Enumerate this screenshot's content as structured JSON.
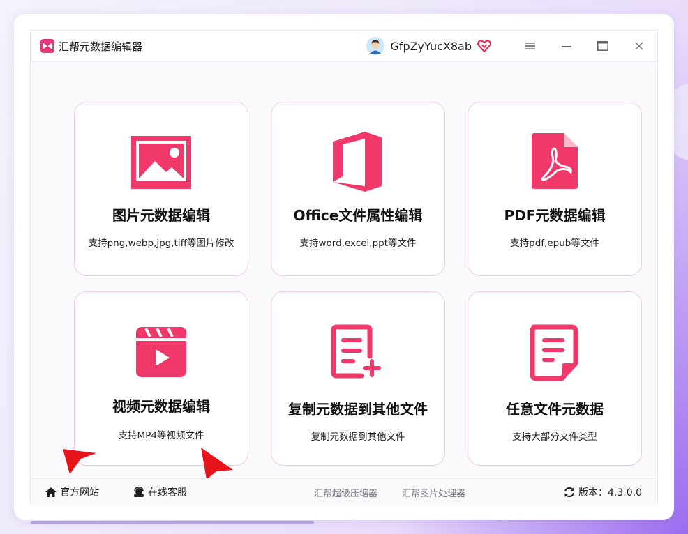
{
  "app": {
    "title": "汇帮元数据编辑器"
  },
  "user": {
    "name": "GfpZyYucX8ab"
  },
  "cards": [
    {
      "title": "图片元数据编辑",
      "subtitle": "支持png,webp,jpg,tiff等图片修改",
      "icon": "image-icon"
    },
    {
      "title": "Office文件属性编辑",
      "subtitle": "支持word,excel,ppt等文件",
      "icon": "office-icon"
    },
    {
      "title": "PDF元数据编辑",
      "subtitle": "支持pdf,epub等文件",
      "icon": "pdf-icon"
    },
    {
      "title": "视频元数据编辑",
      "subtitle": "支持MP4等视频文件",
      "icon": "video-icon"
    },
    {
      "title": "复制元数据到其他文件",
      "subtitle": "复制元数据到其他文件",
      "icon": "copy-document-icon"
    },
    {
      "title": "任意文件元数据",
      "subtitle": "支持大部分文件类型",
      "icon": "file-note-icon"
    }
  ],
  "footer": {
    "website": "官方网站",
    "support": "在线客服",
    "link1": "汇帮超级压缩器",
    "link2": "汇帮图片处理器",
    "version": "版本：4.3.0.0"
  },
  "colors": {
    "accent": "#f0386a",
    "card_border": "#f3c9e6",
    "annotation_arrow": "#e8141c"
  }
}
